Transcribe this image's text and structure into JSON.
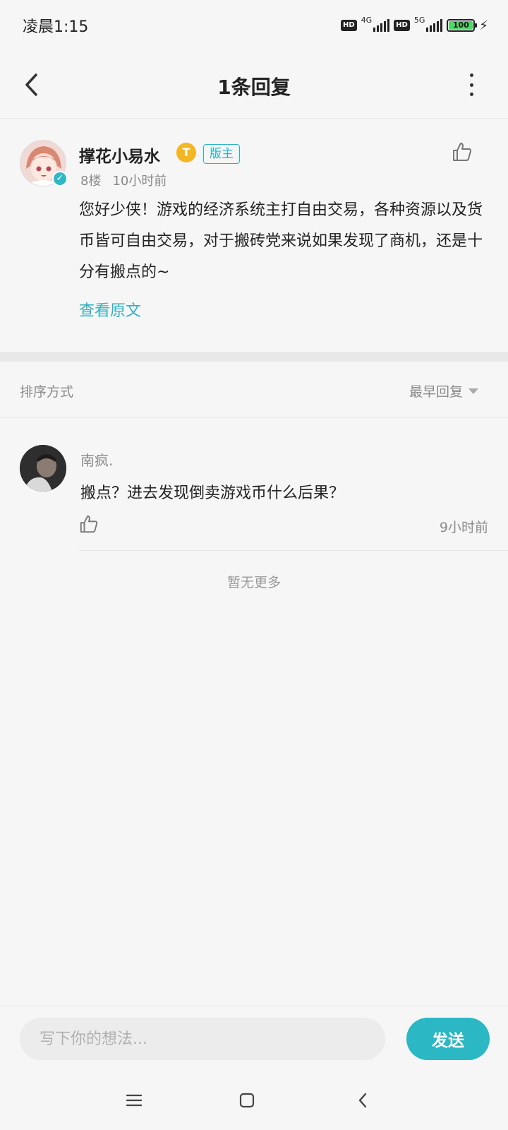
{
  "status_bar": {
    "time": "凌晨1:15",
    "hd1": "HD",
    "net1": "4G",
    "hd2": "HD",
    "net2": "5G",
    "battery": "100",
    "icons": [
      "hd-icon",
      "signal-icon",
      "battery-icon",
      "charging-icon"
    ]
  },
  "header": {
    "title": "1条回复",
    "back_icon": "chevron-left-icon",
    "more_icon": "more-vertical-icon"
  },
  "post": {
    "author": "撑花小易水",
    "level_badge": "T",
    "role_badge": "版主",
    "floor": "8楼",
    "time": "10小时前",
    "content": "您好少侠！游戏的经济系统主打自由交易，各种资源以及货币皆可自由交易，对于搬砖党来说如果发现了商机，还是十分有搬点的~",
    "view_original": "查看原文",
    "like_icon": "thumbs-up-icon"
  },
  "sort": {
    "label": "排序方式",
    "selected": "最早回复"
  },
  "replies": [
    {
      "author": "南疯.",
      "content": "搬点？进去发现倒卖游戏币什么后果？",
      "time": "9小时前"
    }
  ],
  "no_more": "暂无更多",
  "input": {
    "placeholder": "写下你的想法...",
    "send_label": "发送"
  },
  "colors": {
    "accent": "#2bb7c4",
    "background": "#f6f6f6",
    "muted_text": "#8a8a8a"
  },
  "nav": {
    "icons": [
      "menu-icon",
      "home-square-icon",
      "back-icon"
    ]
  }
}
